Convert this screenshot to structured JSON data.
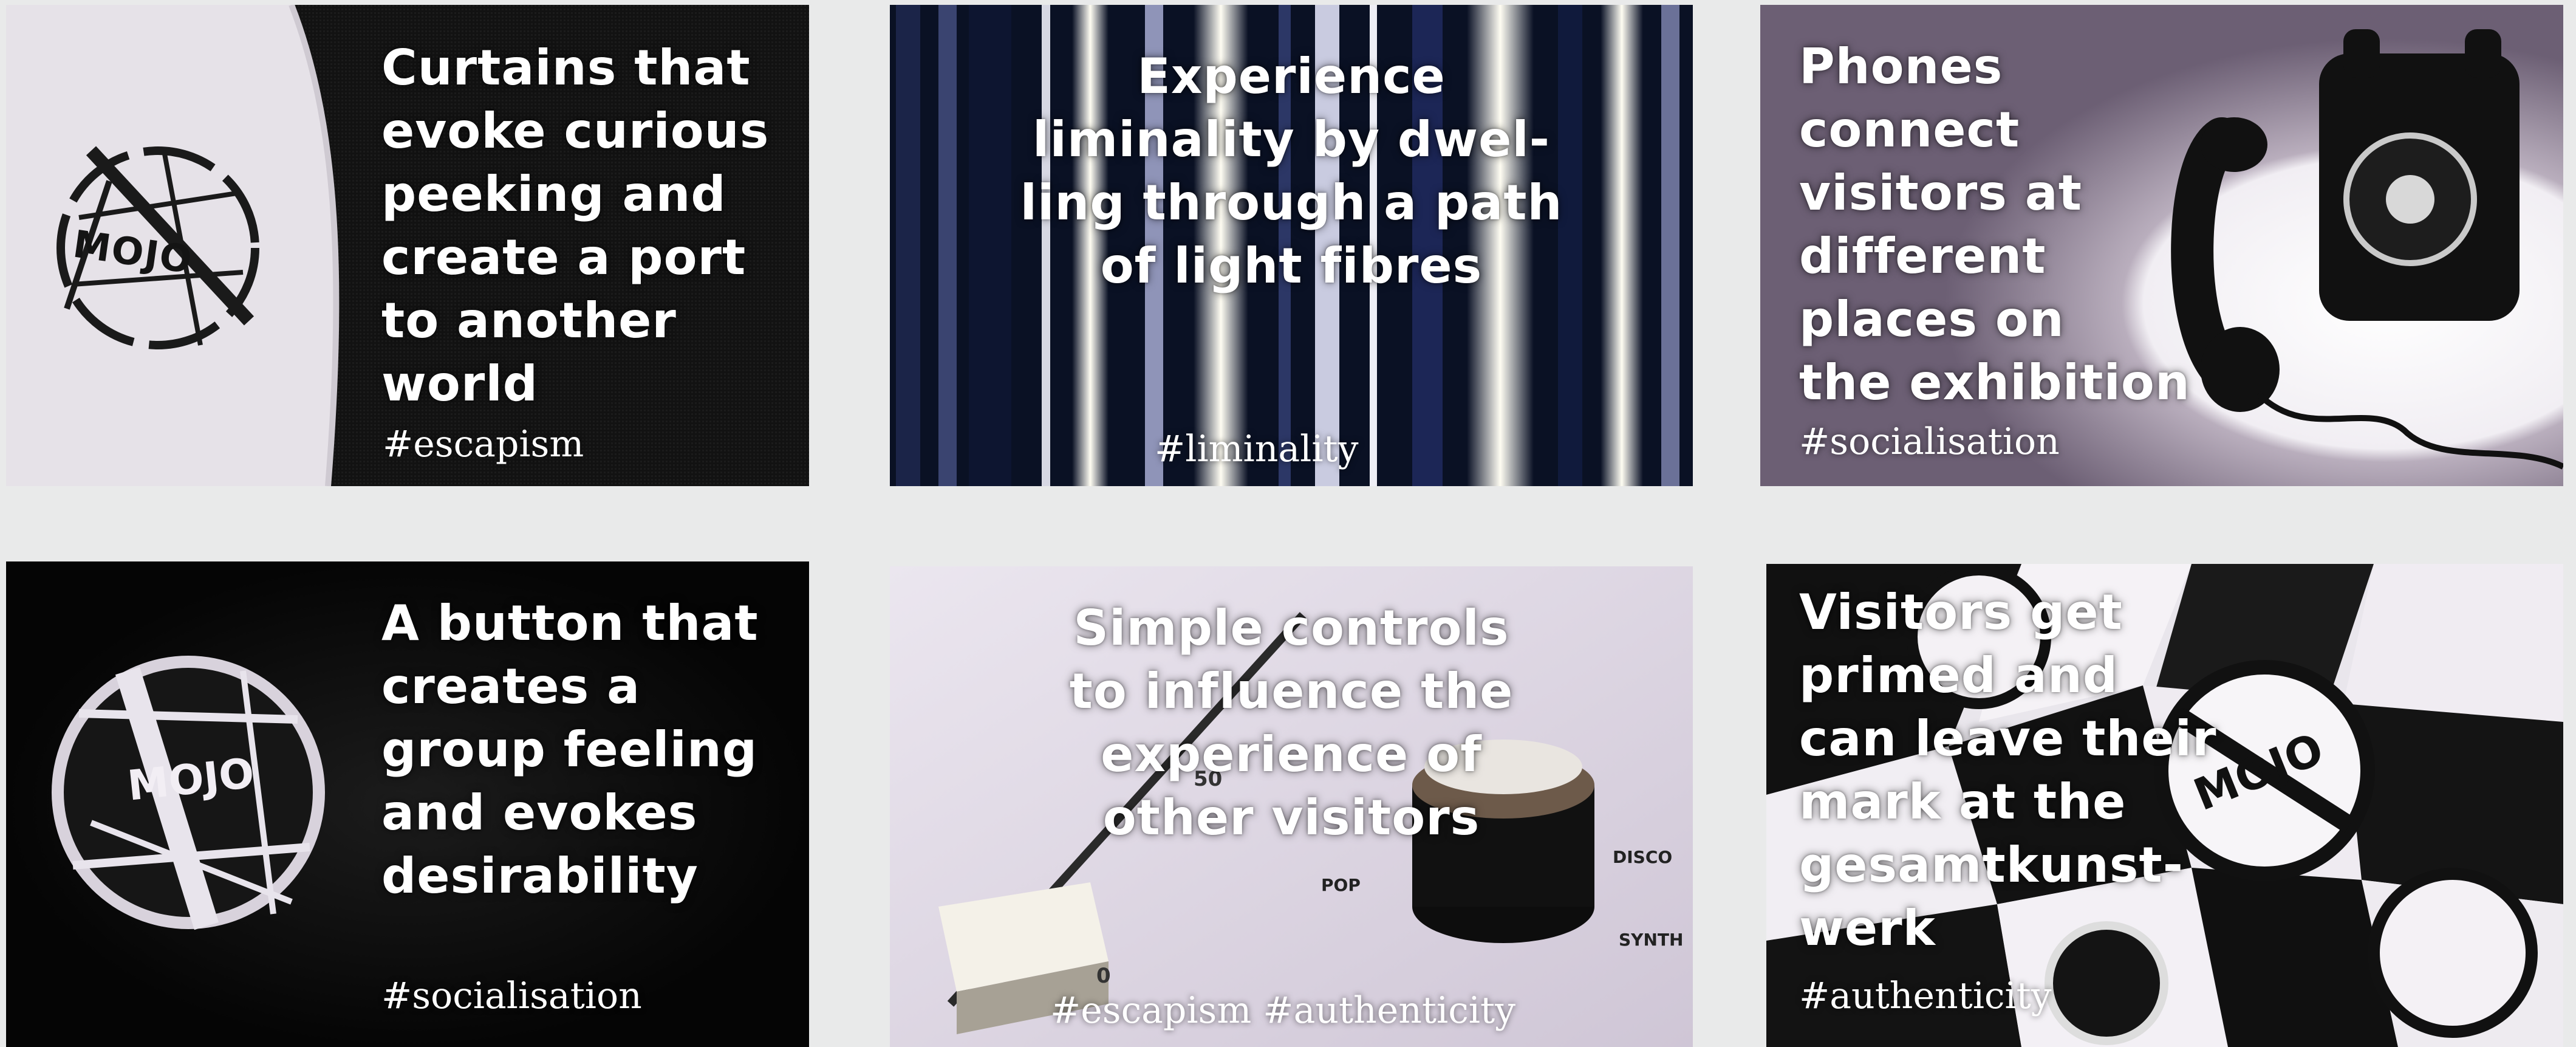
{
  "cards": [
    {
      "headline": "Curtains that\nevoke curious\npeeking and\ncreate a port\nto another\nworld",
      "tag": "#escapism"
    },
    {
      "headline": "Experience\nliminality by dwel-\nling through a path\nof light fibres",
      "tag": "#liminality"
    },
    {
      "headline": "Phones\nconnect\nvisitors at\ndifferent\nplaces on\nthe exhibition",
      "tag": "#socialisation"
    },
    {
      "headline": "A button that\ncreates a\ngroup feeling\nand evokes\ndesirability",
      "tag": "#socialisation"
    },
    {
      "headline": "Simple controls\nto influence the\nexperience of\nother visitors",
      "tag": "#escapism #authenticity"
    },
    {
      "headline": "Visitors get\nprimed and\ncan leave their\nmark at the\ngesamtkunst-\nwerk",
      "tag": "#authenticity"
    }
  ],
  "logo": {
    "text": "MOJO"
  },
  "knob_labels": {
    "pop": "POP",
    "disco": "DISCO",
    "synth": "SYNTH",
    "fifty": "50",
    "zero": "0"
  },
  "colors": {
    "background": "#e9eaea",
    "text": "#ffffff",
    "dark": "#0b0b0b",
    "light": "#ece8ee"
  }
}
